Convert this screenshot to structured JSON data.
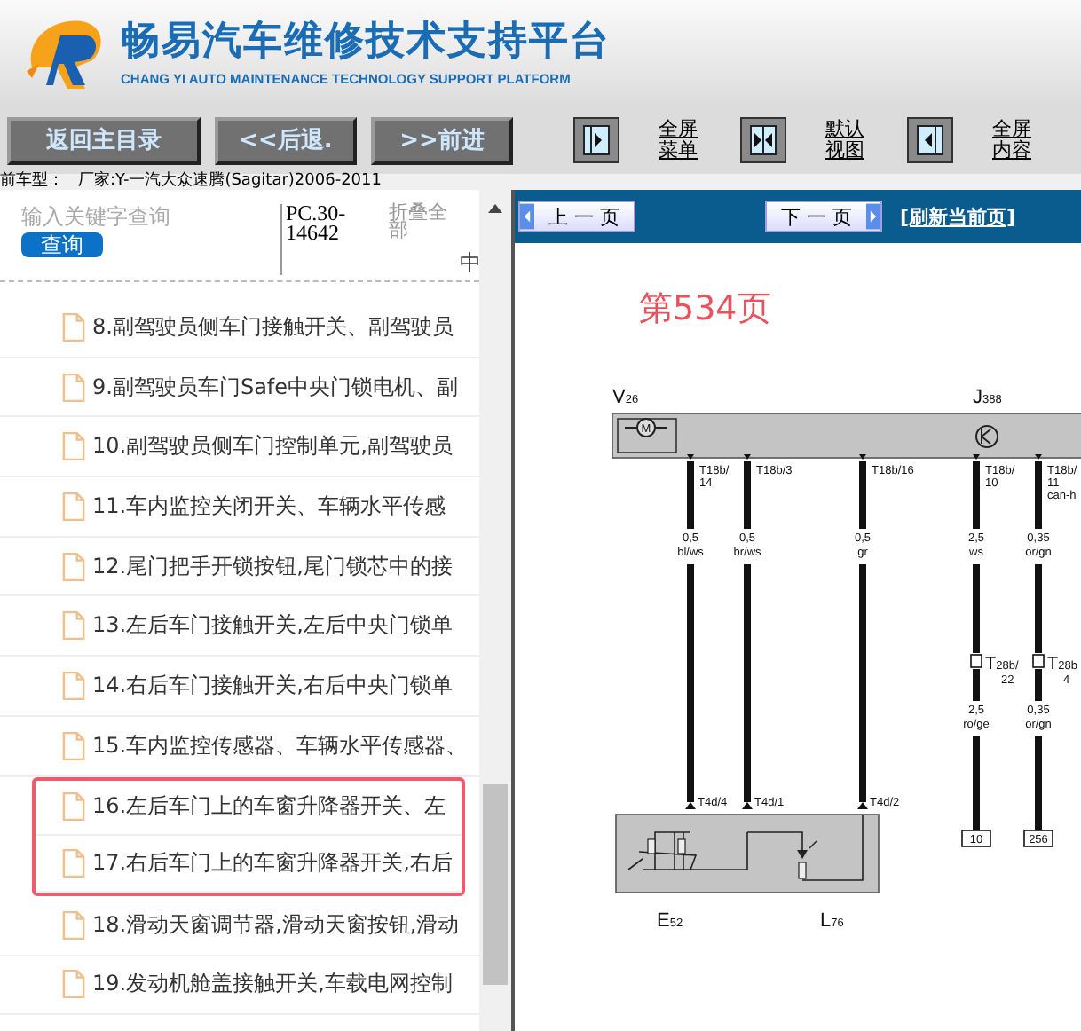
{
  "header": {
    "title": "畅易汽车维修技术支持平台",
    "subtitle": "CHANG YI AUTO MAINTENANCE TECHNOLOGY SUPPORT PLATFORM"
  },
  "toolbar": {
    "buttons": [
      "返回主目录",
      "<<后退.",
      ">>前进"
    ],
    "view_buttons": [
      {
        "kind": "menu-full",
        "label": [
          "全屏",
          "菜单"
        ]
      },
      {
        "kind": "default",
        "label": [
          "默认",
          "视图"
        ]
      },
      {
        "kind": "content-full",
        "label": [
          "全屏",
          "内容"
        ]
      }
    ]
  },
  "current_model": {
    "label": "前车型：",
    "value": "厂家:Y-一汽大众速腾(Sagitar)2006-2011"
  },
  "sidebar": {
    "search": {
      "placeholder": "输入关键字查询",
      "button": "查询"
    },
    "code": "PC.30-14642",
    "collapse_all": "折叠全部",
    "column_3": "中",
    "items": [
      {
        "label": "8.副驾驶员侧车门接触开关、副驾驶员",
        "highlighted": false
      },
      {
        "label": "9.副驾驶员车门Safe中央门锁电机、副",
        "highlighted": false
      },
      {
        "label": "10.副驾驶员侧车门控制单元,副驾驶员",
        "highlighted": false
      },
      {
        "label": "11.车内监控关闭开关、车辆水平传感",
        "highlighted": false
      },
      {
        "label": "12.尾门把手开锁按钮,尾门锁芯中的接",
        "highlighted": false
      },
      {
        "label": "13.左后车门接触开关,左后中央门锁单",
        "highlighted": false
      },
      {
        "label": "14.右后车门接触开关,右后中央门锁单",
        "highlighted": false
      },
      {
        "label": "15.车内监控传感器、车辆水平传感器、",
        "highlighted": false
      },
      {
        "label": "16.左后车门上的车窗升降器开关、左",
        "highlighted": true
      },
      {
        "label": "17.右后车门上的车窗升降器开关,右后",
        "highlighted": true
      },
      {
        "label": "18.滑动天窗调节器,滑动天窗按钮,滑动",
        "highlighted": false
      },
      {
        "label": "19.发动机舱盖接触开关,车载电网控制",
        "highlighted": false
      }
    ]
  },
  "viewer": {
    "prev_button": "上 一 页",
    "next_button": "下 一 页",
    "refresh_link": "[刷新当前页]",
    "page_label": "第534页",
    "diagram": {
      "components": [
        {
          "kind": "motor",
          "label": "V",
          "sub": "26",
          "symbol": "M"
        },
        {
          "kind": "control-unit",
          "label": "J",
          "sub": "388"
        },
        {
          "kind": "switch",
          "label": "E",
          "sub": "52"
        },
        {
          "kind": "lamp",
          "label": "L",
          "sub": "76"
        }
      ],
      "wires": [
        {
          "kind": "to-module",
          "top_pin": [
            "T18b/",
            "14"
          ],
          "spec": [
            "0,5",
            "bl/ws"
          ],
          "bottom_pin": "T4d/4"
        },
        {
          "kind": "to-module",
          "top_pin": [
            "T18b/3"
          ],
          "spec": [
            "0,5",
            "br/ws"
          ],
          "bottom_pin": "T4d/1"
        },
        {
          "kind": "to-module",
          "top_pin": [
            "T18b/16"
          ],
          "spec": [
            "0,5",
            "gr"
          ],
          "bottom_pin": "T4d/2"
        },
        {
          "kind": "to-terminal",
          "top_pin": [
            "T18b/",
            "10"
          ],
          "spec": [
            "2,5",
            "ws"
          ],
          "connector": {
            "label": "T",
            "sub": "28b/",
            "below": "22"
          },
          "lower_spec": [
            "2,5",
            "ro/ge"
          ],
          "terminal": "10"
        },
        {
          "kind": "to-terminal",
          "top_pin": [
            "T18b/",
            "11",
            "can-h"
          ],
          "spec": [
            "0,35",
            "or/gn"
          ],
          "connector": {
            "label": "T",
            "sub": "28b",
            "below": "4"
          },
          "lower_spec": [
            "0,35",
            "or/gn"
          ],
          "terminal": "256"
        }
      ]
    }
  }
}
